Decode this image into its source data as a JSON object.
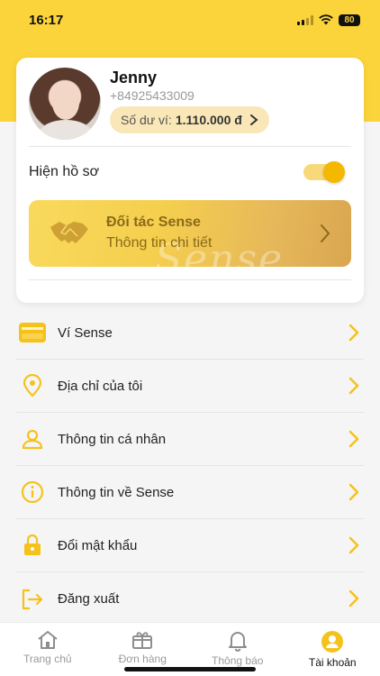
{
  "status_bar": {
    "time": "16:17",
    "battery": "80"
  },
  "profile": {
    "name": "Jenny",
    "phone": "+84925433009",
    "wallet_label": "Số dư ví:",
    "wallet_amount": "1.110.000 đ",
    "show_profile_label": "Hiện hồ sơ",
    "show_profile_on": true
  },
  "partner": {
    "title": "Đối tác Sense",
    "subtitle": "Thông tin chi tiết",
    "watermark": "Sense"
  },
  "menu": {
    "items": [
      {
        "label": "Ví Sense",
        "icon": "wallet-icon"
      },
      {
        "label": "Địa chỉ của tôi",
        "icon": "location-pin-icon"
      },
      {
        "label": "Thông tin cá nhân",
        "icon": "person-icon"
      },
      {
        "label": "Thông tin về Sense",
        "icon": "info-icon"
      },
      {
        "label": "Đổi mật khẩu",
        "icon": "lock-icon"
      },
      {
        "label": "Đăng xuất",
        "icon": "logout-icon"
      }
    ]
  },
  "tabs": [
    {
      "label": "Trang chủ",
      "icon": "home-icon",
      "active": false
    },
    {
      "label": "Đơn hàng",
      "icon": "gift-box-icon",
      "active": false
    },
    {
      "label": "Thông báo",
      "icon": "bell-icon",
      "active": false
    },
    {
      "label": "Tài khoản",
      "icon": "account-icon",
      "active": true
    }
  ],
  "colors": {
    "accent": "#fbd33a",
    "accent_dark": "#f5b800",
    "icon": "#f0b400"
  }
}
